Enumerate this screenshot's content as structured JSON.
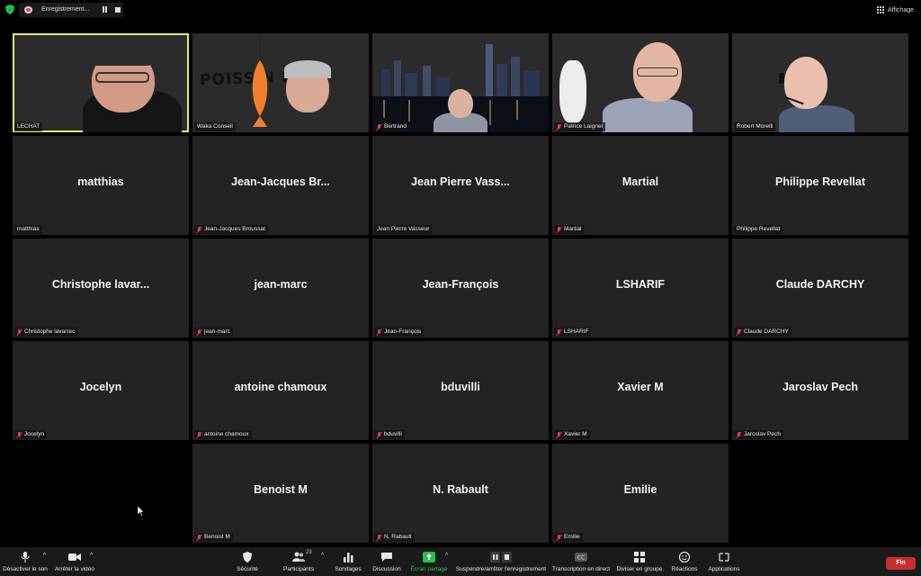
{
  "top_bar": {
    "recording_label": "Enregistrement...",
    "view_label": "Affichage"
  },
  "video_tiles": [
    {
      "caption": "LECHAT",
      "muted": false
    },
    {
      "caption": "Waka Conseil",
      "muted": false,
      "banner_text": "POISS N  RIL !"
    },
    {
      "caption": "Bertrand",
      "muted": true
    },
    {
      "caption": "Patrice Laignel",
      "muted": true
    },
    {
      "caption": "Robert Morelli",
      "muted": false
    }
  ],
  "tiles": [
    {
      "name": "matthias",
      "caption": "matthias",
      "muted": false
    },
    {
      "name": "Jean-Jacques  Br...",
      "caption": "Jean-Jacques Broussat",
      "muted": true
    },
    {
      "name": "Jean  Pierre  Vass...",
      "caption": "Jean Pierre Vasseur",
      "muted": false
    },
    {
      "name": "Martial",
      "caption": "Martial",
      "muted": true
    },
    {
      "name": "Philippe Revellat",
      "caption": "Philippe Revellat",
      "muted": false
    },
    {
      "name": "Christophe  lavar...",
      "caption": "Christophe lavarrec",
      "muted": true
    },
    {
      "name": "jean-marc",
      "caption": "jean-marc",
      "muted": true
    },
    {
      "name": "Jean-François",
      "caption": "Jean-François",
      "muted": true
    },
    {
      "name": "LSHARIF",
      "caption": "LSHARIF",
      "muted": true
    },
    {
      "name": "Claude DARCHY",
      "caption": "Claude DARCHY",
      "muted": true
    },
    {
      "name": "Jocelyn",
      "caption": "Jocelyn",
      "muted": true
    },
    {
      "name": "antoine chamoux",
      "caption": "antoine chamoux",
      "muted": true
    },
    {
      "name": "bduvilli",
      "caption": "bduvilli",
      "muted": true
    },
    {
      "name": "Xavier M",
      "caption": "Xavier M",
      "muted": true
    },
    {
      "name": "Jaroslav Pech",
      "caption": "Jaroslav Pech",
      "muted": true
    },
    {
      "name": "Benoist M",
      "caption": "Benoist M",
      "muted": true
    },
    {
      "name": "N. Rabault",
      "caption": "N. Rabault",
      "muted": true
    },
    {
      "name": "Emilie",
      "caption": "Emilie",
      "muted": true
    }
  ],
  "toolbar": {
    "mute_label": "Désactiver le son",
    "video_label": "Arrêter la vidéo",
    "security_label": "Sécurité",
    "participants_label": "Participants",
    "participants_count": "23",
    "polls_label": "Sondages",
    "chat_label": "Discussion",
    "share_label": "Écran partagé",
    "record_label": "Suspendre/arrêter l'enregistrement",
    "transcript_label": "Transcription en direct",
    "breakout_label": "Diviser en groupe",
    "reactions_label": "Réactions",
    "apps_label": "Applications",
    "end_label": "Fin"
  },
  "colors": {
    "active_speaker_border": "#e6e86a",
    "share_green": "#23c04a",
    "end_red": "#c7302f",
    "tile_bg": "#232323"
  }
}
